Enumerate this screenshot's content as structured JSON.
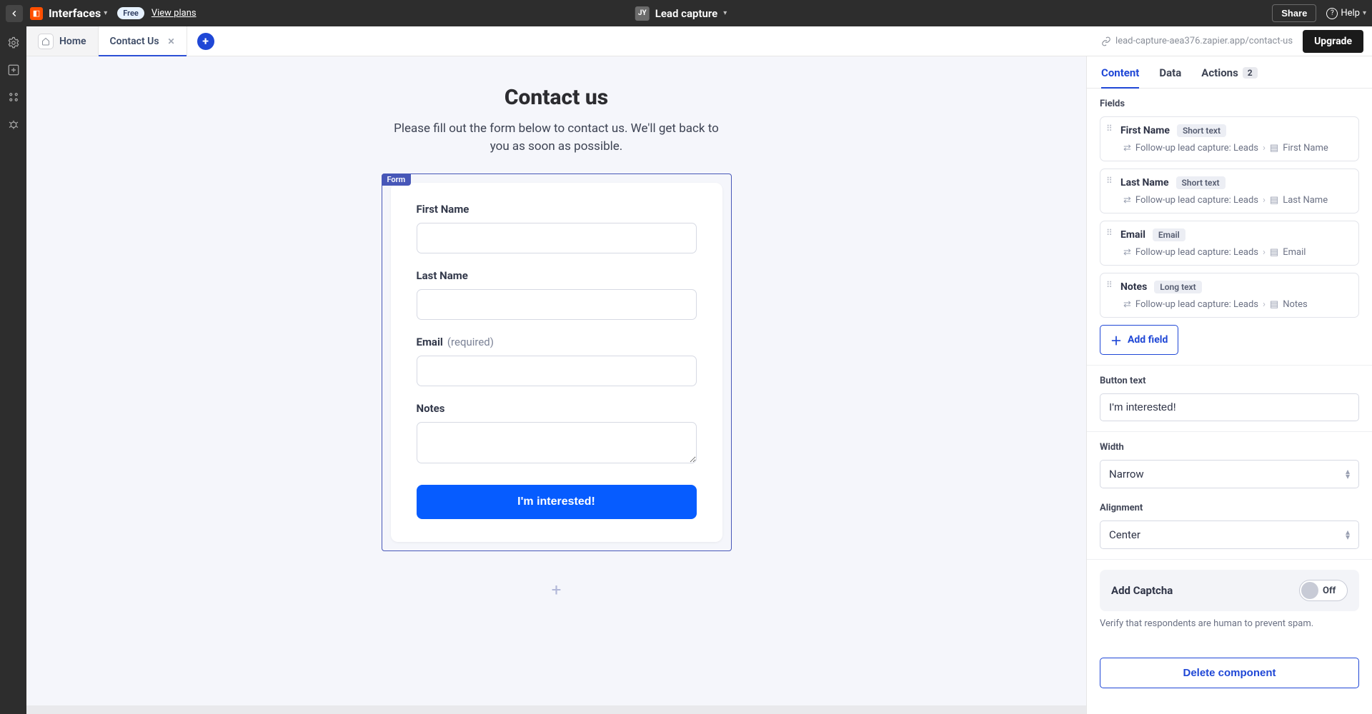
{
  "topbar": {
    "brand": "Interfaces",
    "free_badge": "Free",
    "view_plans": "View plans",
    "avatar_initials": "JY",
    "project_name": "Lead capture",
    "share": "Share",
    "help": "Help"
  },
  "subhead": {
    "tabs": {
      "home": "Home",
      "active": "Contact Us"
    },
    "url": "lead-capture-aea376.zapier.app/contact-us",
    "upgrade": "Upgrade"
  },
  "canvas": {
    "title": "Contact us",
    "description": "Please fill out the form below to contact us. We'll get back to you as soon as possible.",
    "form_tag": "Form",
    "fields": {
      "first_name": {
        "label": "First Name"
      },
      "last_name": {
        "label": "Last Name"
      },
      "email": {
        "label": "Email",
        "req": "(required)"
      },
      "notes": {
        "label": "Notes"
      }
    },
    "submit": "I'm interested!"
  },
  "panel": {
    "tabs": {
      "content": "Content",
      "data": "Data",
      "actions": "Actions",
      "actions_count": "2"
    },
    "fields_label": "Fields",
    "fields": [
      {
        "name": "First Name",
        "type": "Short text",
        "path_a": "Follow-up lead capture: Leads",
        "path_b": "First Name"
      },
      {
        "name": "Last Name",
        "type": "Short text",
        "path_a": "Follow-up lead capture: Leads",
        "path_b": "Last Name"
      },
      {
        "name": "Email",
        "type": "Email",
        "path_a": "Follow-up lead capture: Leads",
        "path_b": "Email"
      },
      {
        "name": "Notes",
        "type": "Long text",
        "path_a": "Follow-up lead capture: Leads",
        "path_b": "Notes"
      }
    ],
    "add_field": "Add field",
    "button_text_label": "Button text",
    "button_text_value": "I'm interested!",
    "width_label": "Width",
    "width_value": "Narrow",
    "align_label": "Alignment",
    "align_value": "Center",
    "captcha_label": "Add Captcha",
    "captcha_state": "Off",
    "captcha_help": "Verify that respondents are human to prevent spam.",
    "delete": "Delete component"
  }
}
